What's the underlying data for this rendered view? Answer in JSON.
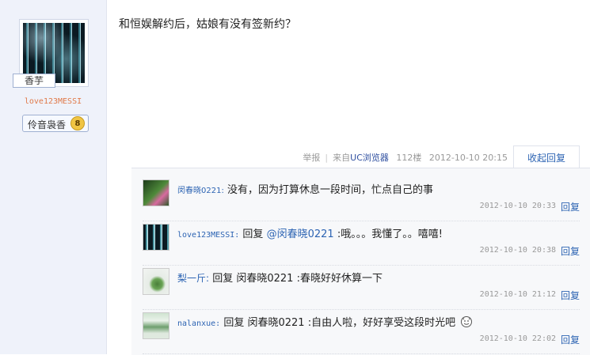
{
  "author": {
    "tag": "香芋",
    "username": "love123MESSI",
    "level_name": "伶音袅香",
    "level_num": "8"
  },
  "post": {
    "content": "和恒娱解约后，姑娘有没有签新约？",
    "report": "举报",
    "source_prefix": "来自",
    "source_client": "UC浏览器",
    "floor": "112楼",
    "time": "2012-10-10 20:15",
    "collapse_label": "收起回复"
  },
  "replies": [
    {
      "user": "闵春晓0221:",
      "text": "没有，因为打算休息一段时间，忙点自己的事",
      "time": "2012-10-10 20:33",
      "reply_label": "回复",
      "avatar_color": "#2f5a2a"
    },
    {
      "user": "love123MESSI:",
      "reply_word": "回复",
      "mention": "@闵春晓0221",
      "text": ":哦。。。我懂了。。嘻嘻!",
      "time": "2012-10-10 20:38",
      "reply_label": "回复",
      "avatar_color": "#163840"
    },
    {
      "user": "梨一斤:",
      "reply_word": "回复",
      "mention": "闵春晓0221",
      "text": ":春晓好好休算一下",
      "time": "2012-10-10 21:12",
      "reply_label": "回复",
      "avatar_color": "#dfe8df"
    },
    {
      "user": "nalanxue:",
      "reply_word": "回复",
      "mention": "闵春晓0221",
      "text": ":自由人啦，好好享受这段时光吧",
      "time": "2012-10-10 22:02",
      "reply_label": "回复",
      "avatar_color": "#cfe3d0"
    }
  ],
  "icons": {
    "emoji": "smiley-face-icon"
  }
}
